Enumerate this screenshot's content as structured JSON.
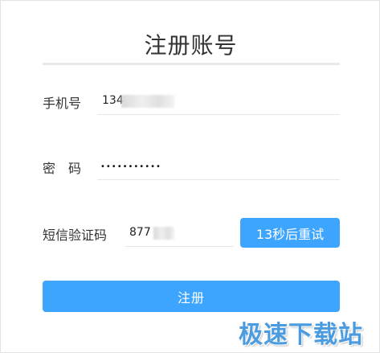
{
  "dialog": {
    "title": "注册账号"
  },
  "form": {
    "phone": {
      "label": "手机号",
      "value": "134"
    },
    "password": {
      "label": "密　码",
      "value": "•••••••••••"
    },
    "sms_code": {
      "label": "短信验证码",
      "value": "877",
      "retry_label": "13秒后重试"
    },
    "submit_label": "注册"
  },
  "watermark": {
    "text": "极速下载站"
  },
  "colors": {
    "accent": "#3ea5ff",
    "watermark": "#4a9be0"
  }
}
